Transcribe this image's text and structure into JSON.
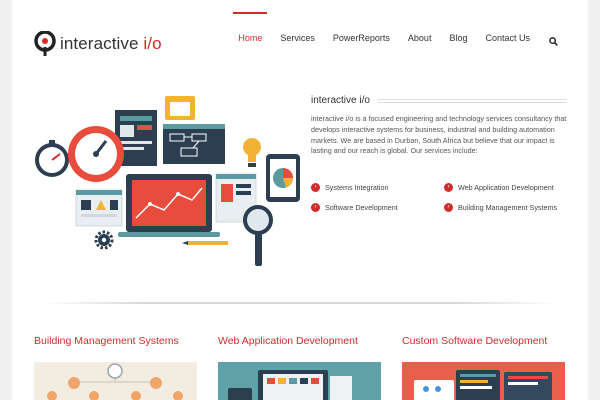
{
  "header": {
    "logo_main": "interactive ",
    "logo_accent": "i/o",
    "nav": [
      {
        "label": "Home",
        "active": true
      },
      {
        "label": "Services",
        "active": false
      },
      {
        "label": "PowerReports",
        "active": false
      },
      {
        "label": "About",
        "active": false
      },
      {
        "label": "Blog",
        "active": false
      },
      {
        "label": "Contact Us",
        "active": false
      }
    ],
    "search_icon": "search-icon"
  },
  "intro": {
    "title": "interactive i/o",
    "body": "interactive i/o is a focused engineering and technology services consultancy that develops interactive systems for business, industrial and building automation markets. We are based in Durban, South Africa but believe that our impact is lasting and our reach is global. Our services include:",
    "services": [
      "Systems Integration",
      "Web Application Development",
      "Software Development",
      "Building Management Systems"
    ]
  },
  "columns": [
    {
      "title": "Building Management Systems"
    },
    {
      "title": "Web Application Development"
    },
    {
      "title": "Custom Software Development"
    }
  ],
  "colors": {
    "accent": "#d22b2b",
    "dark_navy": "#2c3e50",
    "teal": "#5b9aa0"
  }
}
